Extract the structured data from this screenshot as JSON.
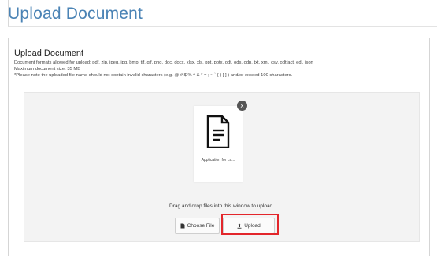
{
  "page": {
    "title": "Upload Document"
  },
  "section": {
    "title": "Upload Document",
    "formats_line": "Document formats allowed for upload: pdf, zip, jpeg, jpg, bmp, tif, gif, png, doc, docx, xlsx, xls, ppt, pptx, odt, ods, odp, txt, xml, csv, odtfact, edi, json",
    "max_size_line": "Maximum document size: 35 MB",
    "note_line": "*Please note the uploaded file name should not contain invalid characters (e.g. @ # $ % ^ & * = ; ~ ` { } [ ] ) and/or exceed 100 characters."
  },
  "dropzone": {
    "file_name": "Application for La...",
    "remove_label": "x",
    "drop_text": "Drag and drop files into this window to upload.",
    "choose_file_label": "Choose File",
    "upload_label": "Upload"
  },
  "icons": {
    "file": "document-icon",
    "choose": "file-icon",
    "upload": "upload-icon",
    "remove": "close-icon"
  },
  "colors": {
    "title": "#4a83b5",
    "highlight": "#e3262b",
    "dropzone_bg": "#f3f3f3"
  }
}
